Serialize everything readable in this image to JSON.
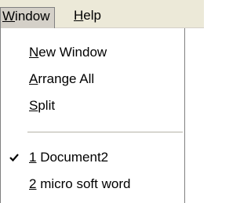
{
  "menubar": {
    "window": {
      "mnemonic": "W",
      "rest": "indow"
    },
    "help": {
      "mnemonic": "H",
      "rest": "elp"
    }
  },
  "menu": {
    "items": [
      {
        "mnemonic": "N",
        "rest": "ew Window"
      },
      {
        "mnemonic": "A",
        "rest": "rrange All"
      },
      {
        "mnemonic": "S",
        "rest": "plit"
      }
    ],
    "documents": [
      {
        "mnemonic": "1",
        "rest": " Document2",
        "checked": true
      },
      {
        "mnemonic": "2",
        "rest": " micro soft word",
        "checked": false
      }
    ]
  },
  "icons": {
    "check": "check-icon"
  }
}
